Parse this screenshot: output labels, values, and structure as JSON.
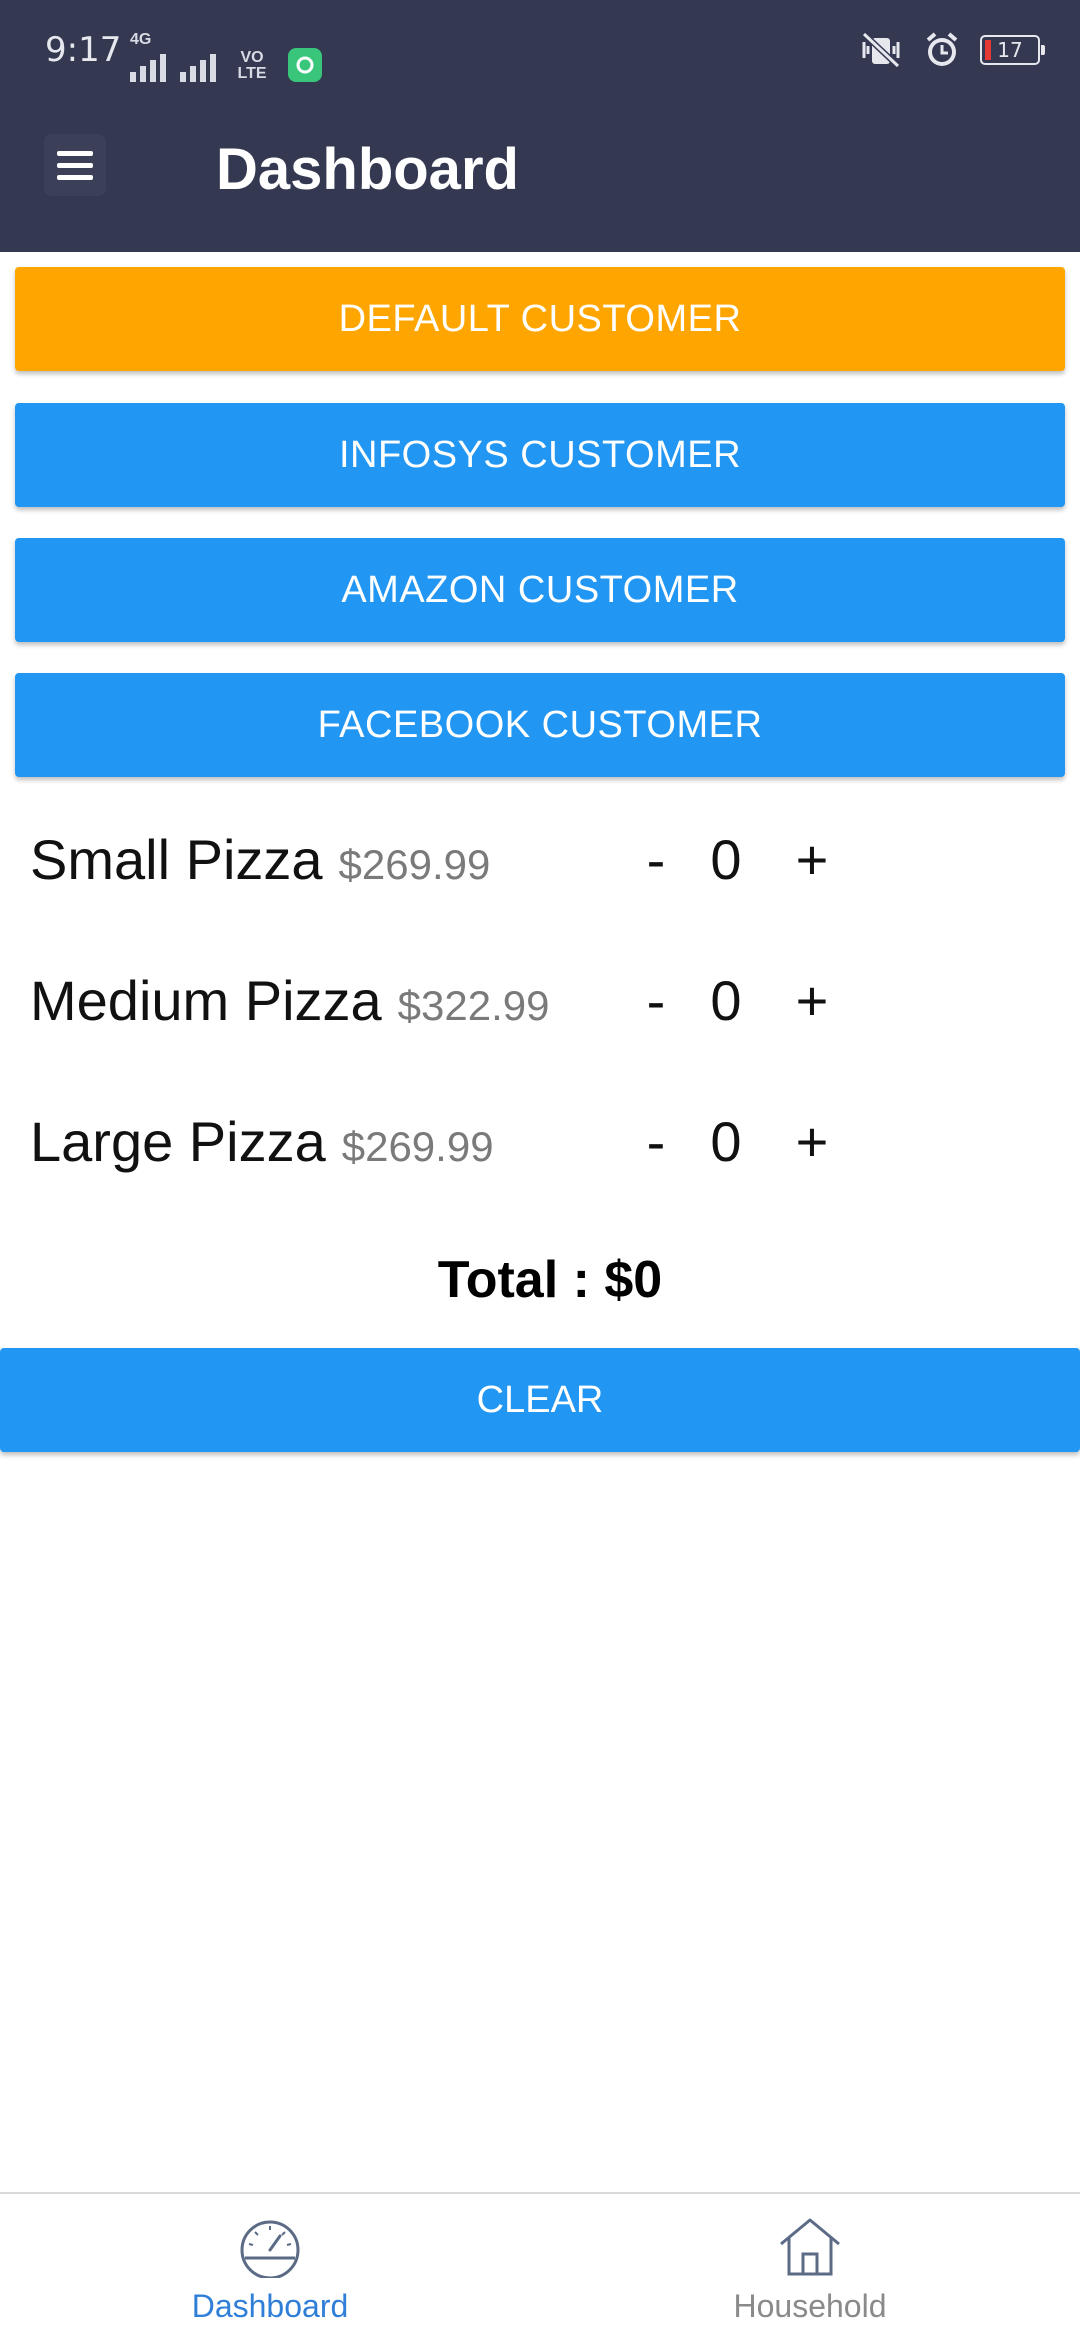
{
  "status_bar": {
    "time": "9:17",
    "network_label": "4G",
    "volte_label": "VO LTE",
    "battery": "17"
  },
  "app_bar": {
    "title": "Dashboard"
  },
  "customers": [
    {
      "label": "DEFAULT CUSTOMER",
      "color": "#FFA500"
    },
    {
      "label": "INFOSYS CUSTOMER",
      "color": "#2196F3"
    },
    {
      "label": "AMAZON CUSTOMER",
      "color": "#2196F3"
    },
    {
      "label": "FACEBOOK CUSTOMER",
      "color": "#2196F3"
    }
  ],
  "pizzas": [
    {
      "name": "Small Pizza",
      "price": "$269.99",
      "minus": "-",
      "qty": "0",
      "plus": "+"
    },
    {
      "name": "Medium Pizza",
      "price": "$322.99",
      "minus": "-",
      "qty": "0",
      "plus": "+"
    },
    {
      "name": "Large Pizza",
      "price": "$269.99",
      "minus": "-",
      "qty": "0",
      "plus": "+"
    }
  ],
  "total_text": "Total : $0",
  "clear_label": "CLEAR",
  "bottom_nav": [
    {
      "label": "Dashboard",
      "icon": "speedometer-icon",
      "active": true,
      "color": "#2f7fd8"
    },
    {
      "label": "Household",
      "icon": "house-icon",
      "active": false,
      "color": "#8a8a8a"
    }
  ],
  "colors": {
    "app_bar": "#343951",
    "primary_button": "#2196F3",
    "accent_button": "#FFA500"
  }
}
